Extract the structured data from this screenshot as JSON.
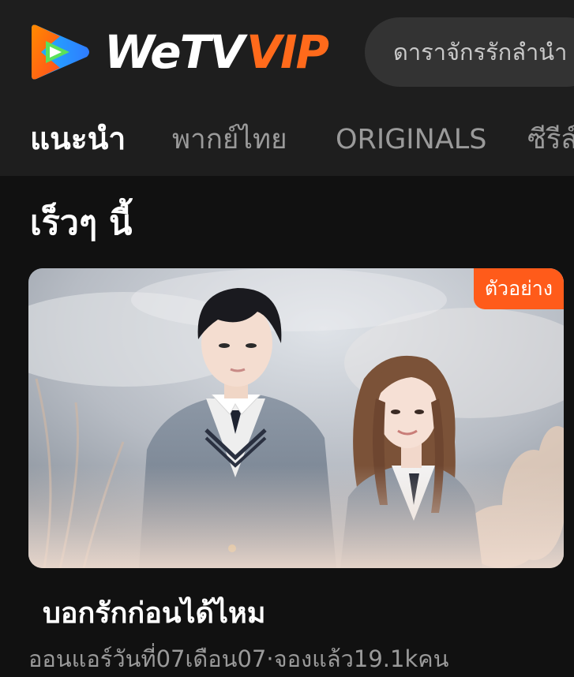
{
  "header": {
    "logo_icon": "wetv-play-logo-icon",
    "brand_main": "WeTV",
    "brand_vip": "VIP",
    "brand_colors": {
      "main": "#ffffff",
      "vip": "#ff6a1b"
    },
    "search_text": "ดาราจักรรักลำนำ"
  },
  "tabs": [
    {
      "label": "แนะนำ",
      "active": true
    },
    {
      "label": "พากย์ไทย",
      "active": false
    },
    {
      "label": "ORIGINALS",
      "active": false
    },
    {
      "label": "ซีรีส์",
      "active": false
    }
  ],
  "section": {
    "title": "เร็วๆ นี้"
  },
  "card": {
    "badge": "ตัวอย่าง",
    "badge_color": "#ff5b1a",
    "title": "บอกรักก่อนได้ไหม",
    "meta": "ออนแอร์วันที่07เดือน07·จองแล้ว19.1kคน"
  }
}
